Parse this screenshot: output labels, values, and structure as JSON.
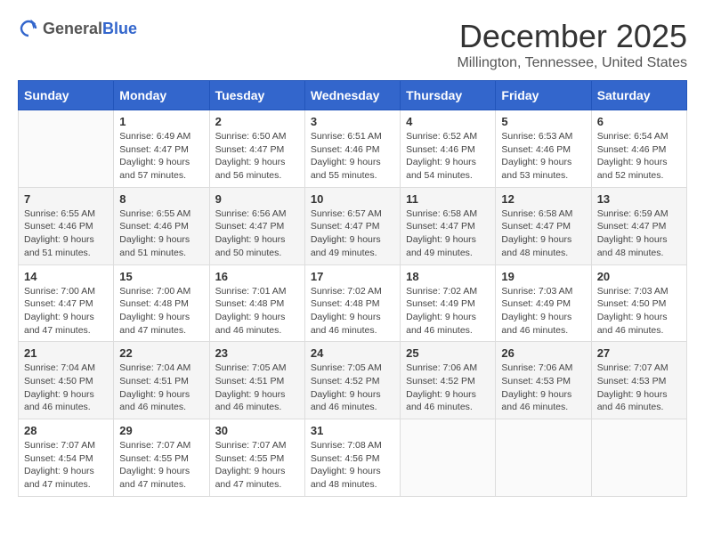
{
  "logo": {
    "general": "General",
    "blue": "Blue"
  },
  "title": "December 2025",
  "location": "Millington, Tennessee, United States",
  "days_of_week": [
    "Sunday",
    "Monday",
    "Tuesday",
    "Wednesday",
    "Thursday",
    "Friday",
    "Saturday"
  ],
  "weeks": [
    [
      {
        "day": "",
        "info": ""
      },
      {
        "day": "1",
        "info": "Sunrise: 6:49 AM\nSunset: 4:47 PM\nDaylight: 9 hours\nand 57 minutes."
      },
      {
        "day": "2",
        "info": "Sunrise: 6:50 AM\nSunset: 4:47 PM\nDaylight: 9 hours\nand 56 minutes."
      },
      {
        "day": "3",
        "info": "Sunrise: 6:51 AM\nSunset: 4:46 PM\nDaylight: 9 hours\nand 55 minutes."
      },
      {
        "day": "4",
        "info": "Sunrise: 6:52 AM\nSunset: 4:46 PM\nDaylight: 9 hours\nand 54 minutes."
      },
      {
        "day": "5",
        "info": "Sunrise: 6:53 AM\nSunset: 4:46 PM\nDaylight: 9 hours\nand 53 minutes."
      },
      {
        "day": "6",
        "info": "Sunrise: 6:54 AM\nSunset: 4:46 PM\nDaylight: 9 hours\nand 52 minutes."
      }
    ],
    [
      {
        "day": "7",
        "info": "Sunrise: 6:55 AM\nSunset: 4:46 PM\nDaylight: 9 hours\nand 51 minutes."
      },
      {
        "day": "8",
        "info": "Sunrise: 6:55 AM\nSunset: 4:46 PM\nDaylight: 9 hours\nand 51 minutes."
      },
      {
        "day": "9",
        "info": "Sunrise: 6:56 AM\nSunset: 4:47 PM\nDaylight: 9 hours\nand 50 minutes."
      },
      {
        "day": "10",
        "info": "Sunrise: 6:57 AM\nSunset: 4:47 PM\nDaylight: 9 hours\nand 49 minutes."
      },
      {
        "day": "11",
        "info": "Sunrise: 6:58 AM\nSunset: 4:47 PM\nDaylight: 9 hours\nand 49 minutes."
      },
      {
        "day": "12",
        "info": "Sunrise: 6:58 AM\nSunset: 4:47 PM\nDaylight: 9 hours\nand 48 minutes."
      },
      {
        "day": "13",
        "info": "Sunrise: 6:59 AM\nSunset: 4:47 PM\nDaylight: 9 hours\nand 48 minutes."
      }
    ],
    [
      {
        "day": "14",
        "info": "Sunrise: 7:00 AM\nSunset: 4:47 PM\nDaylight: 9 hours\nand 47 minutes."
      },
      {
        "day": "15",
        "info": "Sunrise: 7:00 AM\nSunset: 4:48 PM\nDaylight: 9 hours\nand 47 minutes."
      },
      {
        "day": "16",
        "info": "Sunrise: 7:01 AM\nSunset: 4:48 PM\nDaylight: 9 hours\nand 46 minutes."
      },
      {
        "day": "17",
        "info": "Sunrise: 7:02 AM\nSunset: 4:48 PM\nDaylight: 9 hours\nand 46 minutes."
      },
      {
        "day": "18",
        "info": "Sunrise: 7:02 AM\nSunset: 4:49 PM\nDaylight: 9 hours\nand 46 minutes."
      },
      {
        "day": "19",
        "info": "Sunrise: 7:03 AM\nSunset: 4:49 PM\nDaylight: 9 hours\nand 46 minutes."
      },
      {
        "day": "20",
        "info": "Sunrise: 7:03 AM\nSunset: 4:50 PM\nDaylight: 9 hours\nand 46 minutes."
      }
    ],
    [
      {
        "day": "21",
        "info": "Sunrise: 7:04 AM\nSunset: 4:50 PM\nDaylight: 9 hours\nand 46 minutes."
      },
      {
        "day": "22",
        "info": "Sunrise: 7:04 AM\nSunset: 4:51 PM\nDaylight: 9 hours\nand 46 minutes."
      },
      {
        "day": "23",
        "info": "Sunrise: 7:05 AM\nSunset: 4:51 PM\nDaylight: 9 hours\nand 46 minutes."
      },
      {
        "day": "24",
        "info": "Sunrise: 7:05 AM\nSunset: 4:52 PM\nDaylight: 9 hours\nand 46 minutes."
      },
      {
        "day": "25",
        "info": "Sunrise: 7:06 AM\nSunset: 4:52 PM\nDaylight: 9 hours\nand 46 minutes."
      },
      {
        "day": "26",
        "info": "Sunrise: 7:06 AM\nSunset: 4:53 PM\nDaylight: 9 hours\nand 46 minutes."
      },
      {
        "day": "27",
        "info": "Sunrise: 7:07 AM\nSunset: 4:53 PM\nDaylight: 9 hours\nand 46 minutes."
      }
    ],
    [
      {
        "day": "28",
        "info": "Sunrise: 7:07 AM\nSunset: 4:54 PM\nDaylight: 9 hours\nand 47 minutes."
      },
      {
        "day": "29",
        "info": "Sunrise: 7:07 AM\nSunset: 4:55 PM\nDaylight: 9 hours\nand 47 minutes."
      },
      {
        "day": "30",
        "info": "Sunrise: 7:07 AM\nSunset: 4:55 PM\nDaylight: 9 hours\nand 47 minutes."
      },
      {
        "day": "31",
        "info": "Sunrise: 7:08 AM\nSunset: 4:56 PM\nDaylight: 9 hours\nand 48 minutes."
      },
      {
        "day": "",
        "info": ""
      },
      {
        "day": "",
        "info": ""
      },
      {
        "day": "",
        "info": ""
      }
    ]
  ]
}
